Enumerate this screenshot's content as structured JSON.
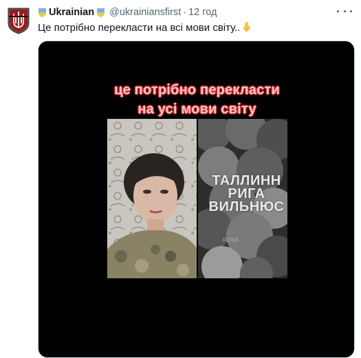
{
  "tweet": {
    "display_name": "Ukrainian",
    "handle": "@ukrainiansfirst",
    "separator": "·",
    "time": "12 год",
    "text": "Це потрібно перекласти на всі мови світу..",
    "emoji_icon": "pointing-down-emoji",
    "verified_badge_icon": "ukraine-shield-badge-icon",
    "avatar_icon": "trident-shield-avatar-icon",
    "more_icon": "more-dots-icon"
  },
  "media": {
    "caption_line1": "це потрібно перекласти",
    "caption_line2": "на усі мови світу",
    "cities": [
      "ТАЛЛИНН",
      "РИГА",
      "ВИЛЬНЮС"
    ],
    "watermark": "ROSS"
  },
  "colors": {
    "text_primary": "#0f1419",
    "text_secondary": "#536471",
    "caption_fill": "#f4c6c6",
    "caption_stroke": "#d12a2a",
    "media_bg": "#000000"
  }
}
